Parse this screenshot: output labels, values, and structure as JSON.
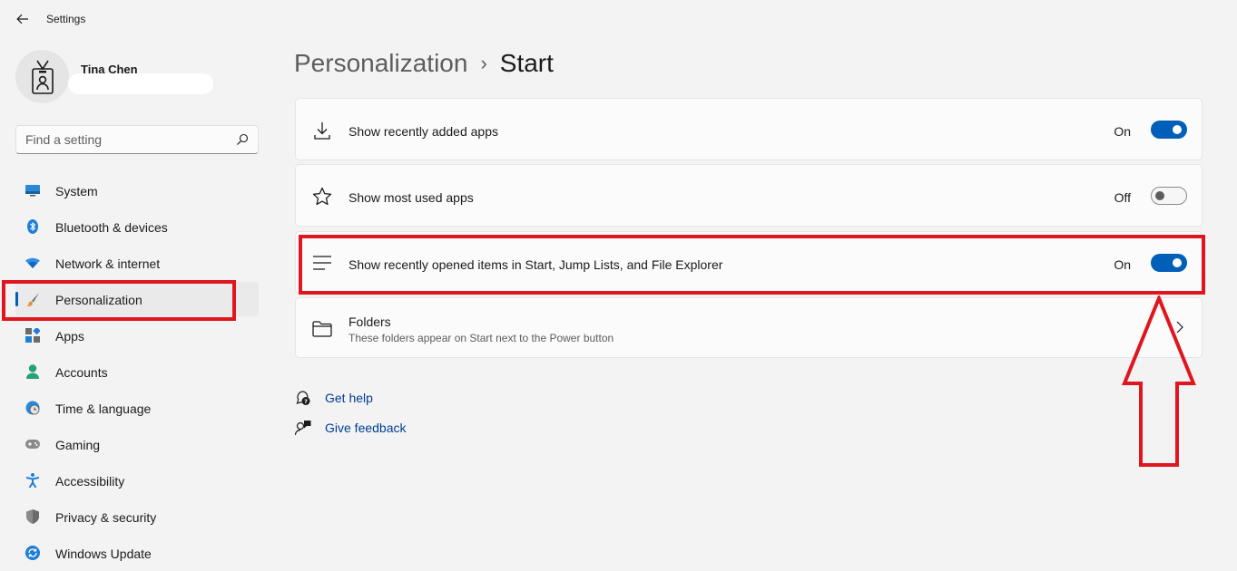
{
  "app": {
    "title": "Settings"
  },
  "user": {
    "name": "Tina Chen"
  },
  "search": {
    "placeholder": "Find a setting"
  },
  "nav": {
    "items": [
      {
        "label": "System",
        "icon": "monitor-icon",
        "active": false
      },
      {
        "label": "Bluetooth & devices",
        "icon": "bluetooth-icon",
        "active": false
      },
      {
        "label": "Network & internet",
        "icon": "wifi-icon",
        "active": false
      },
      {
        "label": "Personalization",
        "icon": "paintbrush-icon",
        "active": true
      },
      {
        "label": "Apps",
        "icon": "apps-icon",
        "active": false
      },
      {
        "label": "Accounts",
        "icon": "person-icon",
        "active": false
      },
      {
        "label": "Time & language",
        "icon": "globe-clock-icon",
        "active": false
      },
      {
        "label": "Gaming",
        "icon": "gamepad-icon",
        "active": false
      },
      {
        "label": "Accessibility",
        "icon": "accessibility-icon",
        "active": false
      },
      {
        "label": "Privacy & security",
        "icon": "shield-icon",
        "active": false
      },
      {
        "label": "Windows Update",
        "icon": "update-icon",
        "active": false
      }
    ]
  },
  "breadcrumb": {
    "parent": "Personalization",
    "separator": "›",
    "current": "Start"
  },
  "settings": [
    {
      "label": "Show recently added apps",
      "icon": "download-icon",
      "state": "On"
    },
    {
      "label": "Show most used apps",
      "icon": "star-icon",
      "state": "Off"
    },
    {
      "label": "Show recently opened items in Start, Jump Lists, and File Explorer",
      "icon": "list-icon",
      "state": "On"
    },
    {
      "label": "Folders",
      "sublabel": "These folders appear on Start next to the Power button",
      "icon": "folder-icon"
    }
  ],
  "links": [
    {
      "label": "Get help",
      "icon": "help-chat-icon"
    },
    {
      "label": "Give feedback",
      "icon": "feedback-icon"
    }
  ],
  "colors": {
    "accent": "#005fb8",
    "annotation": "#e0161f",
    "link": "#003e92"
  }
}
